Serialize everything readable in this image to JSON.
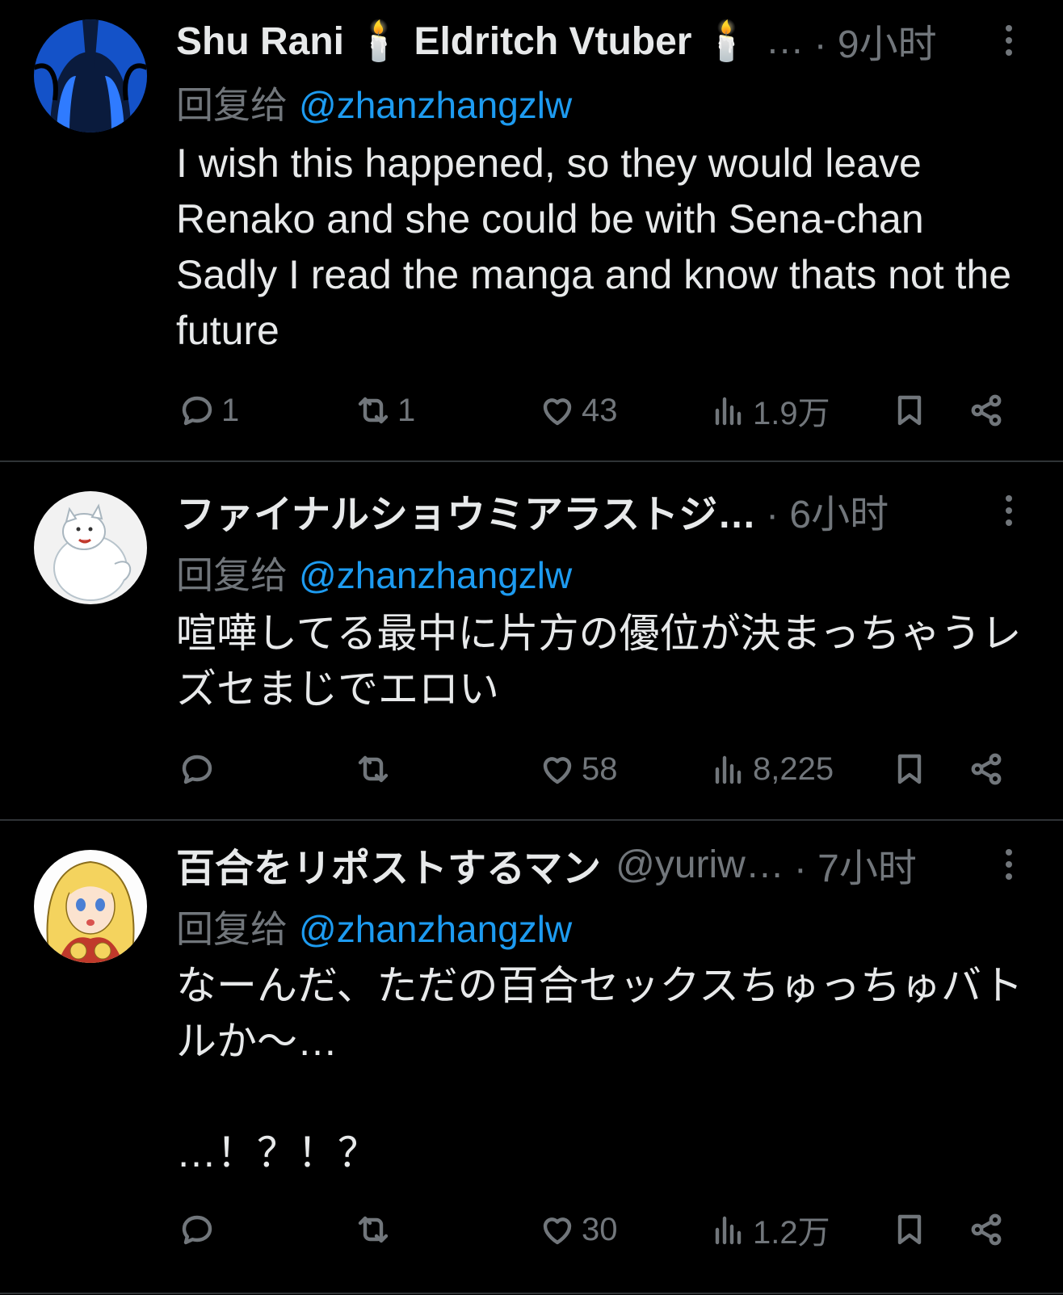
{
  "tweets": [
    {
      "name": "Shu Rani 🕯️ Eldritch Vtuber 🕯️",
      "name_trunc": "…",
      "handle": "",
      "time": "· 9小时",
      "reply_prefix": "回复给",
      "reply_to": "@zhanzhangzlw",
      "body": "I wish this happened, so they would leave Renako and she could be with Sena-chan\nSadly I read the manga and know thats not the future",
      "replies": "1",
      "retweets": "1",
      "likes": "43",
      "views": "1.9万",
      "avatar": "blue-dark-logo"
    },
    {
      "name": "ファイナルショウミアラストジ…",
      "name_trunc": "",
      "handle": "",
      "time": "· 6小时",
      "reply_prefix": "回复给",
      "reply_to": "@zhanzhangzlw",
      "body": "喧嘩してる最中に片方の優位が決まっちゃうレズセまじでエロい",
      "replies": "",
      "retweets": "",
      "likes": "58",
      "views": "8,225",
      "avatar": "white-dog-illustration"
    },
    {
      "name": "百合をリポストするマン",
      "name_trunc": "",
      "handle": "@yuriw…",
      "time": "· 7小时",
      "reply_prefix": "回复给",
      "reply_to": "@zhanzhangzlw",
      "body": "なーんだ、ただの百合セックスちゅっちゅバトルか〜…\n\n…！？！？",
      "replies": "",
      "retweets": "",
      "likes": "30",
      "views": "1.2万",
      "avatar": "blonde-anime-girl"
    }
  ],
  "icons": [
    "reply-icon",
    "retweet-icon",
    "like-icon",
    "views-icon",
    "bookmark-icon",
    "share-icon",
    "more-icon"
  ],
  "colors": {
    "background": "#000000",
    "text": "#e7e9ea",
    "muted": "#71767b",
    "link": "#1d9bf0",
    "divider": "#2f3336"
  }
}
